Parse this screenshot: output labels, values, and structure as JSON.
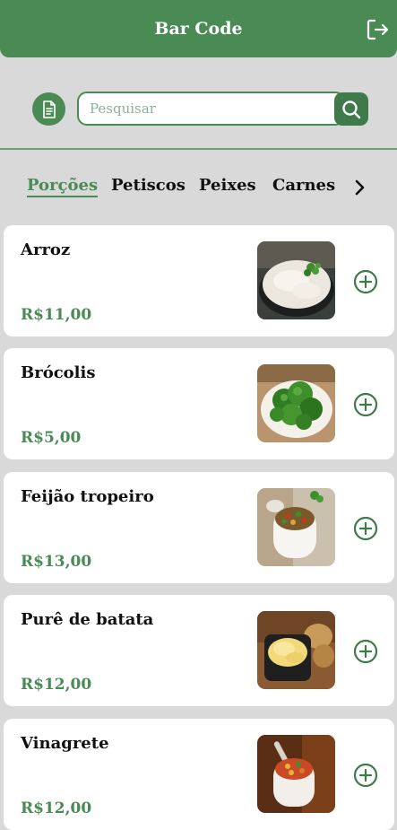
{
  "header": {
    "title": "Bar Code"
  },
  "search": {
    "placeholder": "Pesquisar"
  },
  "tabs": [
    {
      "label": "Porções",
      "active": true
    },
    {
      "label": "Petiscos",
      "active": false
    },
    {
      "label": "Peixes",
      "active": false
    },
    {
      "label": "Carnes",
      "active": false
    }
  ],
  "items": [
    {
      "name": "Arroz",
      "price": "R$11,00",
      "image": "rice-bowl"
    },
    {
      "name": "Brócolis",
      "price": "R$5,00",
      "image": "broccoli-plate"
    },
    {
      "name": "Feijão tropeiro",
      "price": "R$13,00",
      "image": "feijao-tropeiro-bowl"
    },
    {
      "name": "Purê de batata",
      "price": "R$12,00",
      "image": "mashed-potato-bowl"
    },
    {
      "name": "Vinagrete",
      "price": "R$12,00",
      "image": "vinaigrette-bowl"
    }
  ],
  "colors": {
    "primary": "#4a8a55",
    "background": "#d9d9d9",
    "card": "#ffffff"
  },
  "icons": {
    "logout": "logout-icon",
    "document": "document-icon",
    "search": "search-icon",
    "next": "chevron-right-icon",
    "add": "plus-circle-icon"
  }
}
